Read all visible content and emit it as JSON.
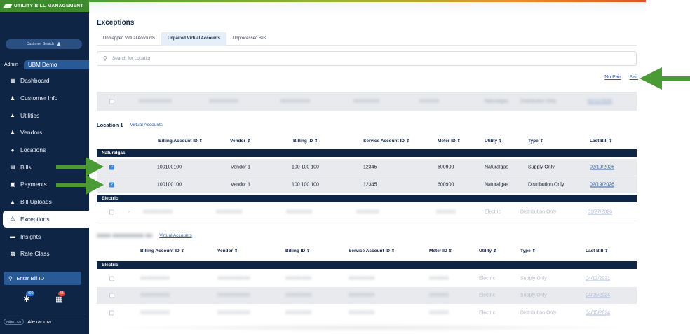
{
  "brand": {
    "title": "UTILITY BILL MANAGEMENT"
  },
  "sidebar": {
    "customer_search": "Customer Search",
    "tenant_role": "Admin",
    "tenant_name": "UBM Demo",
    "items": [
      {
        "label": "Dashboard",
        "icon": "dashboard-icon"
      },
      {
        "label": "Customer Info",
        "icon": "person-icon"
      },
      {
        "label": "Utilities",
        "icon": "utilities-icon"
      },
      {
        "label": "Vendors",
        "icon": "vendor-icon"
      },
      {
        "label": "Locations",
        "icon": "location-pin-icon"
      },
      {
        "label": "Bills",
        "icon": "bill-icon"
      },
      {
        "label": "Payments",
        "icon": "payment-icon"
      },
      {
        "label": "Bill Uploads",
        "icon": "upload-icon"
      },
      {
        "label": "Exceptions",
        "icon": "exclamation-icon"
      },
      {
        "label": "Insights",
        "icon": "insights-icon"
      },
      {
        "label": "Rate Class",
        "icon": "rate-class-icon"
      }
    ],
    "bill_search_placeholder": "Enter Bill ID",
    "notif_a_count": "+99",
    "notif_b_count": "38",
    "admin_toggle": "Admin: On",
    "user_name": "Alexandra"
  },
  "main": {
    "title": "Exceptions",
    "tabs": [
      "Unmapped Virtual Accounts",
      "Unpaired Virtual Accounts",
      "Unprocessed Bills"
    ],
    "search_placeholder": "Search for Location",
    "no_pair": "No Pair",
    "pair": "Pair",
    "blur_row_type": "Naturalgas",
    "blur_row_type2": "Distribution Only",
    "blur_row_date": "02/11/2026",
    "section1": {
      "title": "Location 1",
      "link": "Virtual Accounts",
      "headers": [
        "Billing Account ID ⇕",
        "Vendor ⇕",
        "Billing ID ⇕",
        "Service Account ID ⇕",
        "Meter ID ⇕",
        "Utility ⇕",
        "Type ⇕",
        "Last Bill ⇕"
      ],
      "group1": "Naturalgas",
      "rows": [
        {
          "billing_account_id": "100100100",
          "vendor": "Vendor 1",
          "billing_id": "100 100 100",
          "service_account_id": "12345",
          "meter_id": "600900",
          "utility": "Naturalgas",
          "type": "Supply Only",
          "last_bill": "02/19/2026"
        },
        {
          "billing_account_id": "100100100",
          "vendor": "Vendor 1",
          "billing_id": "100 100 100",
          "service_account_id": "12345",
          "meter_id": "600900",
          "utility": "Naturalgas",
          "type": "Distribution Only",
          "last_bill": "02/19/2026"
        }
      ],
      "group2": "Electric",
      "electric_row": {
        "utility": "Electric",
        "type": "Distribution Only",
        "last_bill": "01/27/2026"
      }
    },
    "section2": {
      "link": "Virtual Accounts",
      "headers": [
        "Billing Account ID ⇕",
        "Vendor ⇕",
        "Billing ID ⇕",
        "Service Account ID ⇕",
        "Meter ID ⇕",
        "Utility ⇕",
        "Type ⇕",
        "Last Bill ⇕"
      ],
      "group": "Electric",
      "rows": [
        {
          "utility": "Electric",
          "type": "Supply Only",
          "last_bill": "04/12/2021"
        },
        {
          "utility": "Electric",
          "type": "Supply Only",
          "last_bill": "04/05/2024"
        },
        {
          "utility": "Electric",
          "type": "Distribution Only",
          "last_bill": "04/05/2024"
        }
      ]
    }
  },
  "colors": {
    "navy": "#0f2545",
    "green_arrow": "#4a9a35",
    "brand_green": "#3e8b2e",
    "link": "#2b5ea8"
  }
}
